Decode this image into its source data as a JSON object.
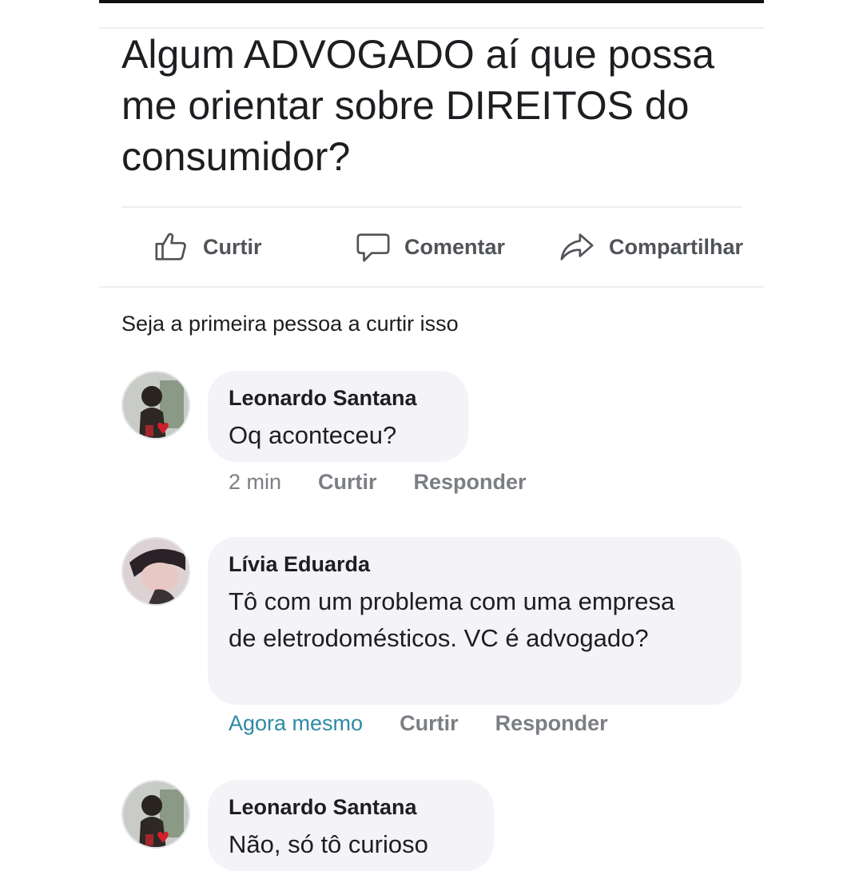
{
  "post": {
    "text": "Algum ADVOGADO aí que possa me orientar sobre DIREITOS do consumidor?"
  },
  "actions": {
    "like_label": "Curtir",
    "comment_label": "Comentar",
    "share_label": "Compartilhar"
  },
  "reactions_text": "Seja a primeira pessoa a curtir isso",
  "comments": [
    {
      "author": "Leonardo Santana",
      "text": "Oq aconteceu?",
      "time": "2 min",
      "like_label": "Curtir",
      "reply_label": "Responder"
    },
    {
      "author": "Lívia Eduarda",
      "text": "Tô com um problema com uma empresa de eletrodomésticos. VC é advogado?",
      "time": "Agora mesmo",
      "like_label": "Curtir",
      "reply_label": "Responder"
    },
    {
      "author": "Leonardo Santana",
      "text": "Não, só tô curioso"
    }
  ],
  "colors": {
    "timestamp_recent": "#2d8aa5",
    "meta_gray": "#7b7e83",
    "bubble_bg": "#f4f3f7"
  }
}
